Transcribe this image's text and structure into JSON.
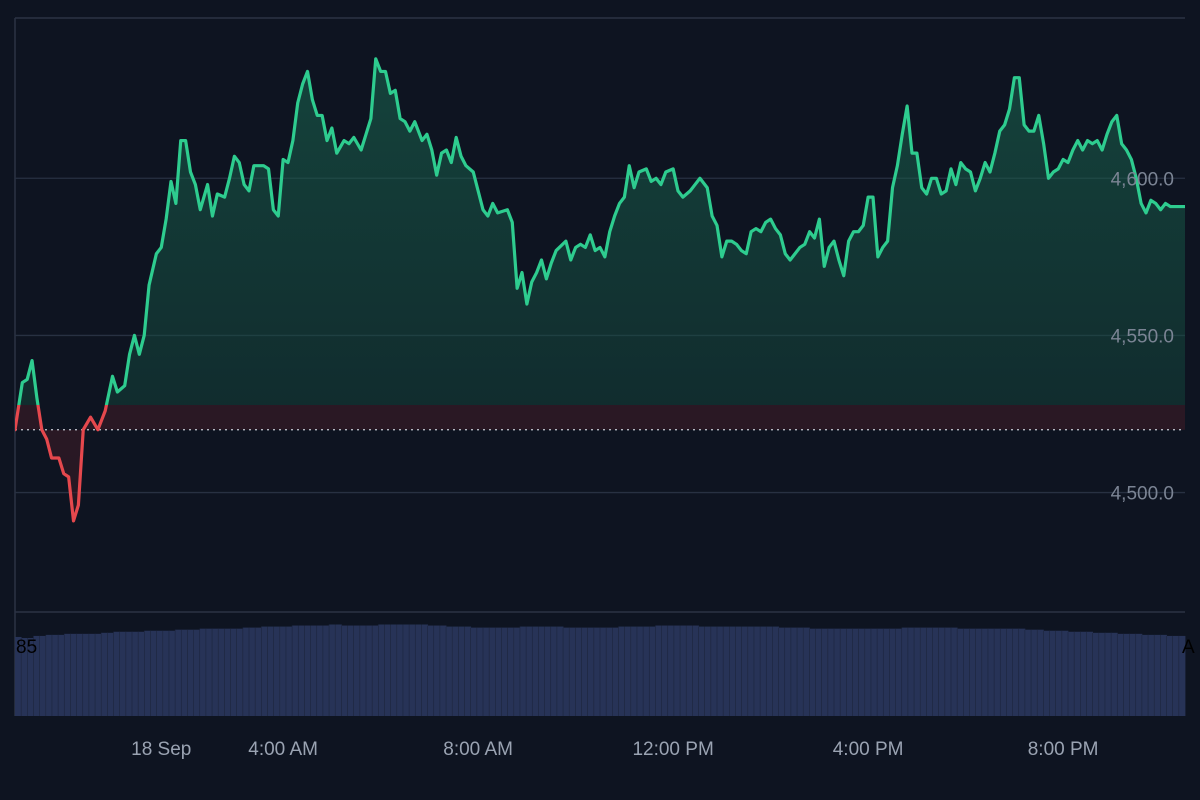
{
  "chart_data": {
    "type": "area",
    "title": "",
    "xlabel": "",
    "ylabel": "",
    "baseline": 4520,
    "ylim": [
      4462,
      4651
    ],
    "yticks": [
      {
        "value": 4500,
        "label": "4,500.0"
      },
      {
        "value": 4550,
        "label": "4,550.0"
      },
      {
        "value": 4600,
        "label": "4,600.0"
      }
    ],
    "xticks": [
      {
        "hour": 1.5,
        "label": "18 Sep"
      },
      {
        "hour": 4,
        "label": "4:00 AM"
      },
      {
        "hour": 8,
        "label": "8:00 AM"
      },
      {
        "hour": 12,
        "label": "12:00 PM"
      },
      {
        "hour": 16,
        "label": "4:00 PM"
      },
      {
        "hour": 20,
        "label": "8:00 PM"
      }
    ],
    "x_hour_range": [
      -1.5,
      22.5
    ],
    "price_series": {
      "name": "",
      "color_up": "#2ecc8f",
      "color_down": "#e5484d",
      "points": [
        [
          -1.5,
          4520
        ],
        [
          -1.35,
          4535
        ],
        [
          -1.25,
          4536
        ],
        [
          -1.15,
          4542
        ],
        [
          -1.05,
          4530
        ],
        [
          -0.95,
          4520
        ],
        [
          -0.85,
          4517
        ],
        [
          -0.75,
          4511
        ],
        [
          -0.6,
          4511
        ],
        [
          -0.5,
          4506
        ],
        [
          -0.4,
          4505
        ],
        [
          -0.3,
          4491
        ],
        [
          -0.2,
          4496
        ],
        [
          -0.1,
          4520
        ],
        [
          0.05,
          4524
        ],
        [
          0.2,
          4520
        ],
        [
          0.35,
          4526
        ],
        [
          0.5,
          4537
        ],
        [
          0.6,
          4532
        ],
        [
          0.75,
          4534
        ],
        [
          0.85,
          4544
        ],
        [
          0.95,
          4550
        ],
        [
          1.05,
          4544
        ],
        [
          1.15,
          4550
        ],
        [
          1.25,
          4566
        ],
        [
          1.4,
          4576
        ],
        [
          1.5,
          4578
        ],
        [
          1.6,
          4587
        ],
        [
          1.7,
          4599
        ],
        [
          1.8,
          4592
        ],
        [
          1.9,
          4612
        ],
        [
          2.0,
          4612
        ],
        [
          2.1,
          4602
        ],
        [
          2.2,
          4598
        ],
        [
          2.3,
          4590
        ],
        [
          2.45,
          4598
        ],
        [
          2.55,
          4588
        ],
        [
          2.65,
          4595
        ],
        [
          2.8,
          4594
        ],
        [
          2.9,
          4600
        ],
        [
          3.0,
          4607
        ],
        [
          3.1,
          4605
        ],
        [
          3.2,
          4598
        ],
        [
          3.3,
          4596
        ],
        [
          3.4,
          4604
        ],
        [
          3.6,
          4604
        ],
        [
          3.7,
          4603
        ],
        [
          3.8,
          4590
        ],
        [
          3.9,
          4588
        ],
        [
          4.0,
          4606
        ],
        [
          4.1,
          4605
        ],
        [
          4.2,
          4612
        ],
        [
          4.3,
          4624
        ],
        [
          4.4,
          4630
        ],
        [
          4.5,
          4634
        ],
        [
          4.6,
          4625
        ],
        [
          4.7,
          4620
        ],
        [
          4.8,
          4620
        ],
        [
          4.9,
          4612
        ],
        [
          5.0,
          4616
        ],
        [
          5.1,
          4608
        ],
        [
          5.25,
          4612
        ],
        [
          5.35,
          4611
        ],
        [
          5.45,
          4613
        ],
        [
          5.6,
          4609
        ],
        [
          5.7,
          4614
        ],
        [
          5.8,
          4619
        ],
        [
          5.9,
          4638
        ],
        [
          6.0,
          4634
        ],
        [
          6.1,
          4634
        ],
        [
          6.2,
          4627
        ],
        [
          6.3,
          4628
        ],
        [
          6.4,
          4619
        ],
        [
          6.5,
          4618
        ],
        [
          6.6,
          4615
        ],
        [
          6.7,
          4618
        ],
        [
          6.85,
          4612
        ],
        [
          6.95,
          4614
        ],
        [
          7.05,
          4609
        ],
        [
          7.15,
          4601
        ],
        [
          7.25,
          4608
        ],
        [
          7.35,
          4609
        ],
        [
          7.45,
          4605
        ],
        [
          7.55,
          4613
        ],
        [
          7.65,
          4607
        ],
        [
          7.75,
          4604
        ],
        [
          7.9,
          4602
        ],
        [
          8.0,
          4596
        ],
        [
          8.1,
          4590
        ],
        [
          8.2,
          4588
        ],
        [
          8.3,
          4592
        ],
        [
          8.4,
          4589
        ],
        [
          8.6,
          4590
        ],
        [
          8.7,
          4586
        ],
        [
          8.8,
          4565
        ],
        [
          8.9,
          4570
        ],
        [
          9.0,
          4560
        ],
        [
          9.1,
          4567
        ],
        [
          9.2,
          4570
        ],
        [
          9.3,
          4574
        ],
        [
          9.4,
          4568
        ],
        [
          9.5,
          4573
        ],
        [
          9.6,
          4577
        ],
        [
          9.8,
          4580
        ],
        [
          9.9,
          4574
        ],
        [
          10.0,
          4578
        ],
        [
          10.1,
          4579
        ],
        [
          10.2,
          4578
        ],
        [
          10.3,
          4582
        ],
        [
          10.4,
          4577
        ],
        [
          10.5,
          4578
        ],
        [
          10.6,
          4575
        ],
        [
          10.7,
          4583
        ],
        [
          10.8,
          4588
        ],
        [
          10.9,
          4592
        ],
        [
          11.0,
          4594
        ],
        [
          11.1,
          4604
        ],
        [
          11.2,
          4597
        ],
        [
          11.3,
          4602
        ],
        [
          11.45,
          4603
        ],
        [
          11.55,
          4599
        ],
        [
          11.65,
          4600
        ],
        [
          11.75,
          4598
        ],
        [
          11.85,
          4602
        ],
        [
          12.0,
          4603
        ],
        [
          12.1,
          4596
        ],
        [
          12.2,
          4594
        ],
        [
          12.35,
          4596
        ],
        [
          12.45,
          4598
        ],
        [
          12.55,
          4600
        ],
        [
          12.7,
          4597
        ],
        [
          12.8,
          4588
        ],
        [
          12.9,
          4585
        ],
        [
          13.0,
          4575
        ],
        [
          13.1,
          4580
        ],
        [
          13.2,
          4580
        ],
        [
          13.3,
          4579
        ],
        [
          13.4,
          4577
        ],
        [
          13.5,
          4576
        ],
        [
          13.6,
          4583
        ],
        [
          13.7,
          4584
        ],
        [
          13.8,
          4583
        ],
        [
          13.9,
          4586
        ],
        [
          14.0,
          4587
        ],
        [
          14.1,
          4584
        ],
        [
          14.2,
          4582
        ],
        [
          14.3,
          4576
        ],
        [
          14.4,
          4574
        ],
        [
          14.5,
          4576
        ],
        [
          14.6,
          4578
        ],
        [
          14.7,
          4579
        ],
        [
          14.8,
          4583
        ],
        [
          14.9,
          4581
        ],
        [
          15.0,
          4587
        ],
        [
          15.1,
          4572
        ],
        [
          15.2,
          4578
        ],
        [
          15.3,
          4580
        ],
        [
          15.4,
          4574
        ],
        [
          15.5,
          4569
        ],
        [
          15.6,
          4580
        ],
        [
          15.7,
          4583
        ],
        [
          15.8,
          4583
        ],
        [
          15.9,
          4585
        ],
        [
          16.0,
          4594
        ],
        [
          16.1,
          4594
        ],
        [
          16.2,
          4575
        ],
        [
          16.3,
          4578
        ],
        [
          16.4,
          4580
        ],
        [
          16.5,
          4597
        ],
        [
          16.6,
          4604
        ],
        [
          16.7,
          4614
        ],
        [
          16.8,
          4623
        ],
        [
          16.9,
          4608
        ],
        [
          17.0,
          4608
        ],
        [
          17.1,
          4597
        ],
        [
          17.2,
          4595
        ],
        [
          17.3,
          4600
        ],
        [
          17.4,
          4600
        ],
        [
          17.5,
          4595
        ],
        [
          17.6,
          4596
        ],
        [
          17.7,
          4603
        ],
        [
          17.8,
          4598
        ],
        [
          17.9,
          4605
        ],
        [
          18.0,
          4603
        ],
        [
          18.1,
          4602
        ],
        [
          18.2,
          4596
        ],
        [
          18.3,
          4600
        ],
        [
          18.4,
          4605
        ],
        [
          18.5,
          4602
        ],
        [
          18.6,
          4608
        ],
        [
          18.7,
          4615
        ],
        [
          18.8,
          4617
        ],
        [
          18.9,
          4622
        ],
        [
          19.0,
          4632
        ],
        [
          19.1,
          4632
        ],
        [
          19.2,
          4617
        ],
        [
          19.3,
          4615
        ],
        [
          19.4,
          4615
        ],
        [
          19.5,
          4620
        ],
        [
          19.6,
          4611
        ],
        [
          19.7,
          4600
        ],
        [
          19.8,
          4602
        ],
        [
          19.9,
          4603
        ],
        [
          20.0,
          4606
        ],
        [
          20.1,
          4605
        ],
        [
          20.2,
          4609
        ],
        [
          20.3,
          4612
        ],
        [
          20.4,
          4609
        ],
        [
          20.5,
          4612
        ],
        [
          20.6,
          4611
        ],
        [
          20.7,
          4612
        ],
        [
          20.8,
          4609
        ],
        [
          20.9,
          4614
        ],
        [
          21.0,
          4618
        ],
        [
          21.1,
          4620
        ],
        [
          21.2,
          4611
        ],
        [
          21.3,
          4609
        ],
        [
          21.4,
          4606
        ],
        [
          21.5,
          4600
        ],
        [
          21.6,
          4592
        ],
        [
          21.7,
          4589
        ],
        [
          21.8,
          4593
        ],
        [
          21.9,
          4592
        ],
        [
          22.0,
          4590
        ],
        [
          22.1,
          4592
        ],
        [
          22.2,
          4591
        ],
        [
          22.5,
          4591
        ]
      ]
    },
    "volume_series": {
      "name": "",
      "color": "#273357",
      "ylim": [
        0,
        100
      ],
      "values": [
        76,
        75,
        75,
        77,
        77,
        78,
        78,
        78,
        79,
        79,
        79,
        79,
        79,
        79,
        80,
        80,
        81,
        81,
        81,
        81,
        81,
        82,
        82,
        82,
        82,
        82,
        83,
        83,
        83,
        83,
        84,
        84,
        84,
        84,
        84,
        84,
        84,
        85,
        85,
        85,
        86,
        86,
        86,
        86,
        86,
        87,
        87,
        87,
        87,
        87,
        87,
        88,
        88,
        87,
        87,
        87,
        87,
        87,
        87,
        88,
        88,
        88,
        88,
        88,
        88,
        88,
        88,
        87,
        87,
        87,
        86,
        86,
        86,
        86,
        85,
        85,
        85,
        85,
        85,
        85,
        85,
        85,
        86,
        86,
        86,
        86,
        86,
        86,
        86,
        85,
        85,
        85,
        85,
        85,
        85,
        85,
        85,
        85,
        86,
        86,
        86,
        86,
        86,
        86,
        87,
        87,
        87,
        87,
        87,
        87,
        87,
        86,
        86,
        86,
        86,
        86,
        86,
        86,
        86,
        86,
        86,
        86,
        86,
        86,
        85,
        85,
        85,
        85,
        85,
        84,
        84,
        84,
        84,
        84,
        84,
        84,
        84,
        84,
        84,
        84,
        84,
        84,
        84,
        84,
        85,
        85,
        85,
        85,
        85,
        85,
        85,
        85,
        85,
        84,
        84,
        84,
        84,
        84,
        84,
        84,
        84,
        84,
        84,
        84,
        83,
        83,
        83,
        82,
        82,
        82,
        82,
        81,
        81,
        81,
        81,
        80,
        80,
        80,
        80,
        79,
        79,
        79,
        79,
        78,
        78,
        78,
        78,
        77,
        77,
        77
      ],
      "labels": {
        "left": "85",
        "right": "A"
      }
    }
  }
}
